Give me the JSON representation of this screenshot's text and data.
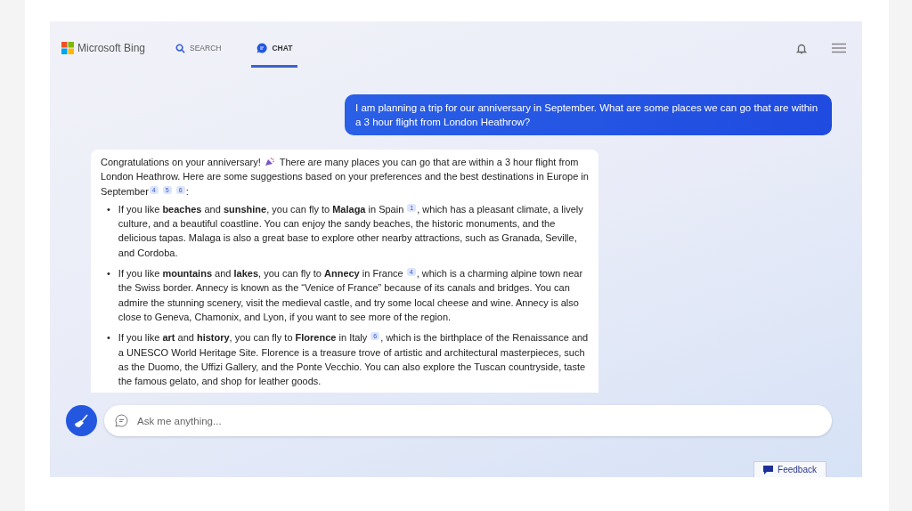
{
  "header": {
    "logo": "Microsoft Bing",
    "tabs": [
      {
        "label": "SEARCH",
        "kind": "search",
        "selected": false
      },
      {
        "label": "CHAT",
        "kind": "chat",
        "selected": true
      }
    ]
  },
  "user_message": "I am planning a trip for our anniversary in September. What are some places we can go that are within a 3 hour flight from London Heathrow?",
  "bot_message": {
    "intro_before": "Congratulations on your anniversary!",
    "intro_after": "There are many places you can go that are within a 3 hour flight from London Heathrow. Here are some suggestions based on your preferences and the best destinations in Europe in September$^{4}$ $^{5}$ $^{6}$:",
    "bullets": [
      {
        "marker": "•",
        "text": "If you like **beaches** and **sunshine**, you can fly to **Malaga** in Spain $^{1}$, which has a pleasant climate, a lively culture, and a beautiful coastline. You can enjoy the sandy beaches, the historic monuments, and the delicious tapas. Malaga is also a great base to explore other nearby attractions, such as Granada, Seville, and Cordoba."
      },
      {
        "marker": "•",
        "text": "If you like **mountains** and **lakes**, you can fly to **Annecy** in France $^{4}$, which is a charming alpine town near the Swiss border. Annecy is known as the “Venice of France” because of its canals and bridges. You can admire the stunning scenery, visit the medieval castle, and try some local cheese and wine. Annecy is also close to Geneva, Chamonix, and Lyon, if you want to see more of the region."
      },
      {
        "marker": "•",
        "text": "If you like **art** and **history**, you can fly to **Florence** in Italy $^{6}$, which is the birthplace of the Renaissance and a UNESCO World Heritage Site. Florence is a treasure trove of artistic and architectural masterpieces, such as the Duomo, the Uffizi Gallery, and the Ponte Vecchio. You can also explore the Tuscan countryside, taste the famous gelato, and shop for leather goods."
      }
    ]
  },
  "input": {
    "placeholder": "Ask me anything..."
  },
  "feedback": "Feedback"
}
